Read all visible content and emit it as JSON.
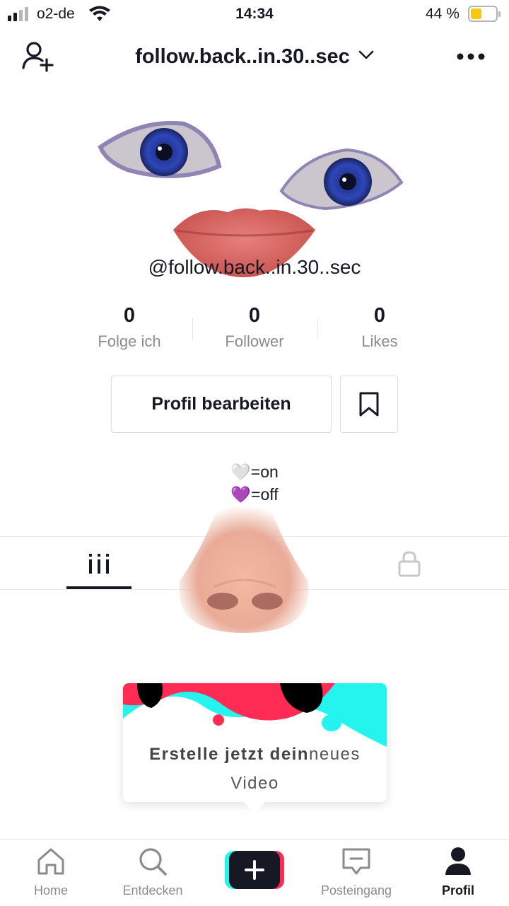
{
  "status_bar": {
    "carrier": "o2-de",
    "time": "14:34",
    "battery": "44 %",
    "battery_level": 0.44,
    "battery_color": "#f5c90f"
  },
  "header": {
    "username": "follow.back..in.30..sec",
    "add_user_icon": "person-plus-icon",
    "more_icon": "ellipsis-icon",
    "dropdown_icon": "chevron-down-icon"
  },
  "profile": {
    "handle": "@follow.back..in.30..sec",
    "stats": [
      {
        "value": "0",
        "label": "Folge ich"
      },
      {
        "value": "0",
        "label": "Follower"
      },
      {
        "value": "0",
        "label": "Likes"
      }
    ],
    "edit_button": "Profil bearbeiten",
    "bio_lines": [
      "🤍=on",
      "💜=off"
    ]
  },
  "tabs": {
    "videos_icon": "grid-icon",
    "private_icon": "lock-icon"
  },
  "promo": {
    "text_bold": "Erstelle jetzt dein",
    "text_rest": "neues",
    "text_line2": "Video"
  },
  "nav": {
    "items": [
      {
        "label": "Home",
        "icon": "home-icon"
      },
      {
        "label": "Entdecken",
        "icon": "search-icon"
      },
      {
        "label": "",
        "icon": "plus-icon"
      },
      {
        "label": "Posteingang",
        "icon": "inbox-icon"
      },
      {
        "label": "Profil",
        "icon": "profile-icon"
      }
    ],
    "accent_cyan": "#25f4ee",
    "accent_red": "#fe2c55"
  }
}
